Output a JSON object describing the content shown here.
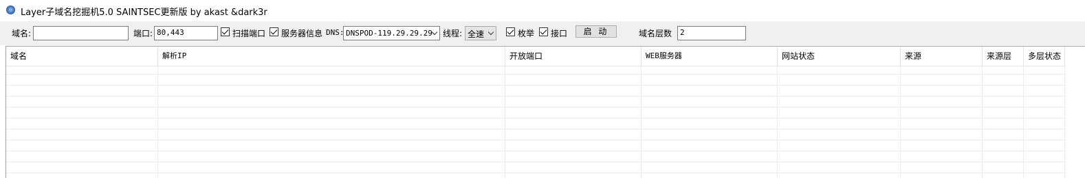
{
  "window": {
    "title": "Layer子域名挖掘机5.0 SAINTSEC更新版 by akast &dark3r",
    "icon": "app-globe-icon"
  },
  "toolbar": {
    "domain_label": "域名:",
    "domain_value": "",
    "port_label": "端口:",
    "port_value": "80,443",
    "scan_ports_label": "扫描端口",
    "scan_ports_checked": true,
    "server_info_label": "服务器信息",
    "server_info_checked": true,
    "dns_label": "DNS:",
    "dns_value": "DNSPOD-119.29.29.29",
    "threads_label": "线程:",
    "threads_value": "全速",
    "enumerate_label": "枚举",
    "enumerate_checked": true,
    "api_label": "接口",
    "api_checked": true,
    "start_button": "启 动",
    "levels_label": "域名层数",
    "levels_value": "2"
  },
  "table": {
    "columns": [
      "域名",
      "解析IP",
      "开放端口",
      "WEB服务器",
      "网站状态",
      "来源",
      "来源层",
      "多层状态"
    ],
    "rows": []
  }
}
